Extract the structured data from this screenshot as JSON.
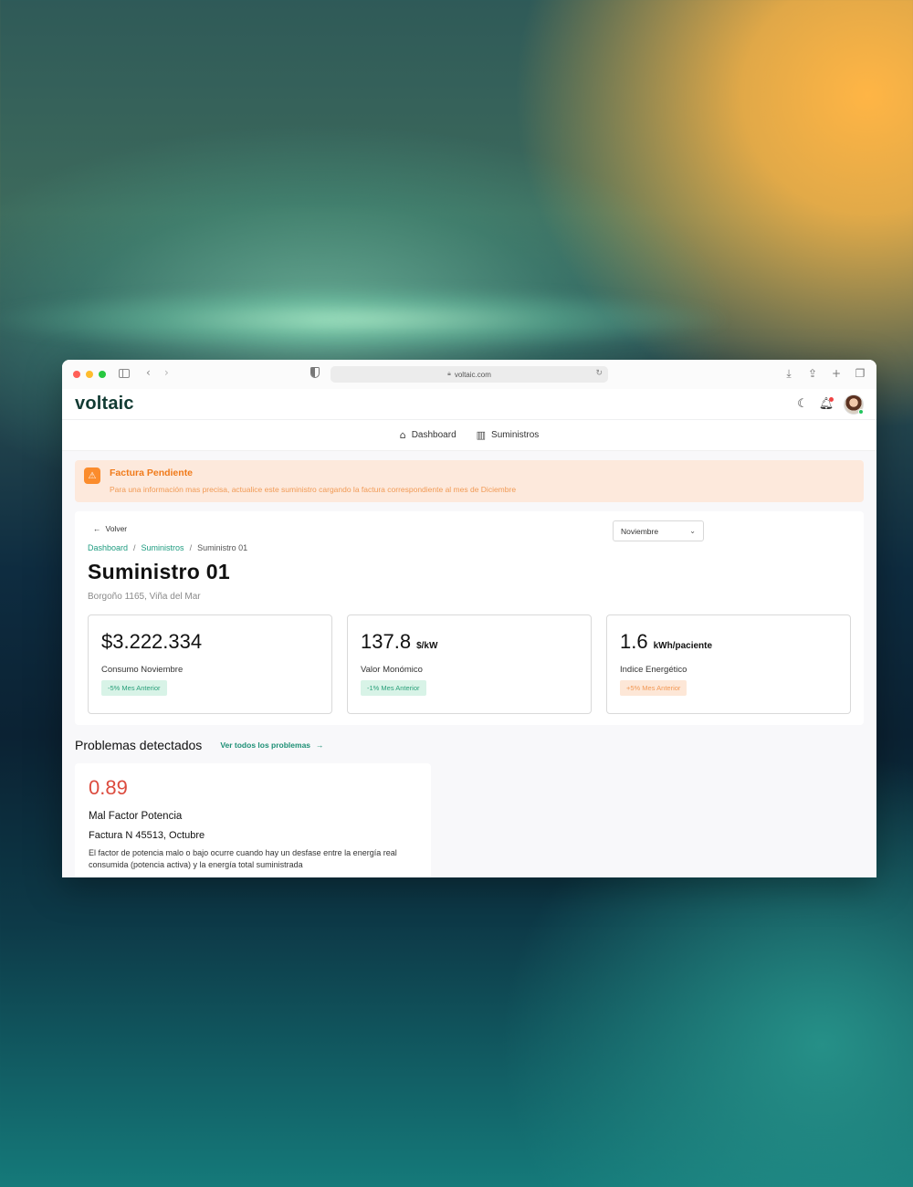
{
  "browser": {
    "url": "voltaic.com"
  },
  "app": {
    "logo": "voltaic"
  },
  "nav": {
    "items": [
      {
        "label": "Dashboard",
        "icon": "home-icon"
      },
      {
        "label": "Suministros",
        "icon": "buildings-icon"
      }
    ]
  },
  "alert": {
    "title": "Factura Pendiente",
    "text": "Para una información mas precisa, actualice este suministro cargando la factura correspondiente al mes de Diciembre"
  },
  "panel": {
    "back_label": "Volver",
    "month_select": "Noviembre",
    "breadcrumb": [
      "Dashboard",
      "Suministros",
      "Suministro 01"
    ],
    "title": "Suministro 01",
    "address": "Borgoño 1165, Viña del Mar"
  },
  "metrics": [
    {
      "value": "$3.222.334",
      "unit": "",
      "label": "Consumo Noviembre",
      "badge": "-5% Mes Anterior",
      "badge_type": "green"
    },
    {
      "value": "137.8",
      "unit": "$/kW",
      "label": "Valor Monómico",
      "badge": "-1% Mes Anterior",
      "badge_type": "green"
    },
    {
      "value": "1.6",
      "unit": "kWh/paciente",
      "label": "Indice Energético",
      "badge": "+5% Mes Anterior",
      "badge_type": "orange"
    }
  ],
  "problems": {
    "title": "Problemas detectados",
    "link": "Ver todos los problemas",
    "items": [
      {
        "value": "0.89",
        "name": "Mal Factor Potencia",
        "invoice": "Factura N 45513, Octubre",
        "description": "El factor de potencia malo o bajo ocurre cuando hay un desfase entre la energía real consumida (potencia activa) y la energía total suministrada"
      }
    ]
  },
  "colors": {
    "brand": "#123b33",
    "accent": "#1f9c80",
    "alert": "#fb8c2c",
    "problem_value": "#dc4b3e"
  }
}
